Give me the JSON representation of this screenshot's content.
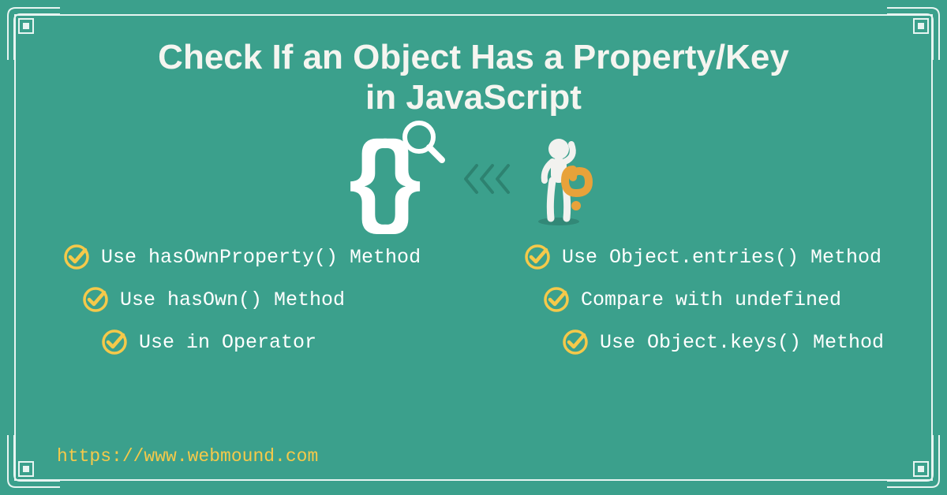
{
  "title_line1": "Check If an Object Has a Property/Key",
  "title_line2": "in JavaScript",
  "left_items": [
    "Use hasOwnProperty() Method",
    "Use hasOwn() Method",
    "Use in Operator"
  ],
  "right_items": [
    "Use Object.entries() Method",
    "Compare with undefined",
    "Use Object.keys() Method"
  ],
  "url": "https://www.webmound.com"
}
